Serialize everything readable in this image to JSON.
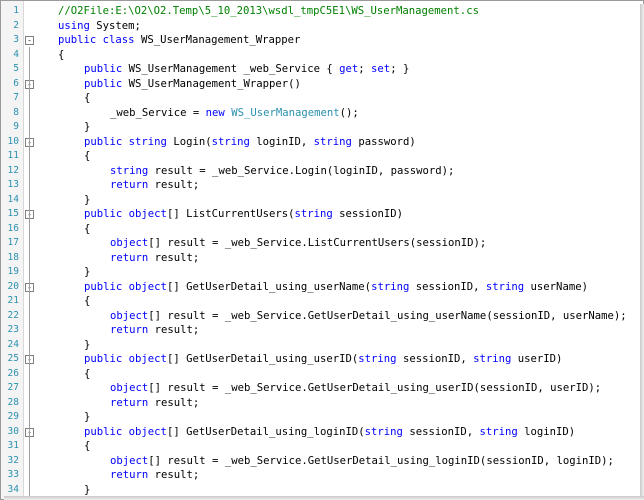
{
  "editor": {
    "lines": [
      {
        "n": "1",
        "indent": 0,
        "tokens": [
          {
            "t": "//O2File:E:\\O2\\O2.Temp\\5_10_2013\\wsdl_tmpC5E1\\WS_UserManagement.cs",
            "c": "cm"
          }
        ]
      },
      {
        "n": "2",
        "indent": 0,
        "tokens": [
          {
            "t": "using",
            "c": "kw"
          },
          {
            "t": " System;",
            "c": "pl"
          }
        ]
      },
      {
        "n": "3",
        "indent": 0,
        "fold": "-",
        "tokens": [
          {
            "t": "public",
            "c": "kw"
          },
          {
            "t": " ",
            "c": "pl"
          },
          {
            "t": "class",
            "c": "kw"
          },
          {
            "t": " WS_UserManagement_Wrapper",
            "c": "pl"
          }
        ]
      },
      {
        "n": "4",
        "indent": 0,
        "tokens": [
          {
            "t": "{",
            "c": "pl"
          }
        ]
      },
      {
        "n": "5",
        "indent": 1,
        "tokens": [
          {
            "t": "public",
            "c": "kw"
          },
          {
            "t": " WS_UserManagement _web_Service { ",
            "c": "pl"
          },
          {
            "t": "get",
            "c": "kw"
          },
          {
            "t": "; ",
            "c": "pl"
          },
          {
            "t": "set",
            "c": "kw"
          },
          {
            "t": "; }",
            "c": "pl"
          }
        ]
      },
      {
        "n": "6",
        "indent": 1,
        "fold": "-",
        "tokens": [
          {
            "t": "public",
            "c": "kw"
          },
          {
            "t": " WS_UserManagement_Wrapper()",
            "c": "pl"
          }
        ]
      },
      {
        "n": "7",
        "indent": 1,
        "tokens": [
          {
            "t": "{",
            "c": "pl"
          }
        ]
      },
      {
        "n": "8",
        "indent": 2,
        "tokens": [
          {
            "t": "_web_Service = ",
            "c": "pl"
          },
          {
            "t": "new",
            "c": "kw"
          },
          {
            "t": " ",
            "c": "pl"
          },
          {
            "t": "WS_UserManagement",
            "c": "ty"
          },
          {
            "t": "();",
            "c": "pl"
          }
        ]
      },
      {
        "n": "9",
        "indent": 1,
        "tokens": [
          {
            "t": "}",
            "c": "pl"
          }
        ]
      },
      {
        "n": "10",
        "indent": 1,
        "fold": "-",
        "tokens": [
          {
            "t": "public",
            "c": "kw"
          },
          {
            "t": " ",
            "c": "pl"
          },
          {
            "t": "string",
            "c": "kw"
          },
          {
            "t": " Login(",
            "c": "pl"
          },
          {
            "t": "string",
            "c": "kw"
          },
          {
            "t": " loginID, ",
            "c": "pl"
          },
          {
            "t": "string",
            "c": "kw"
          },
          {
            "t": " password)",
            "c": "pl"
          }
        ]
      },
      {
        "n": "11",
        "indent": 1,
        "tokens": [
          {
            "t": "{",
            "c": "pl"
          }
        ]
      },
      {
        "n": "12",
        "indent": 2,
        "tokens": [
          {
            "t": "string",
            "c": "kw"
          },
          {
            "t": " result = _web_Service.Login(loginID, password);",
            "c": "pl"
          }
        ]
      },
      {
        "n": "13",
        "indent": 2,
        "tokens": [
          {
            "t": "return",
            "c": "kw"
          },
          {
            "t": " result;",
            "c": "pl"
          }
        ]
      },
      {
        "n": "14",
        "indent": 1,
        "tokens": [
          {
            "t": "}",
            "c": "pl"
          }
        ]
      },
      {
        "n": "15",
        "indent": 1,
        "fold": "-",
        "tokens": [
          {
            "t": "public",
            "c": "kw"
          },
          {
            "t": " ",
            "c": "pl"
          },
          {
            "t": "object",
            "c": "kw"
          },
          {
            "t": "[] ListCurrentUsers(",
            "c": "pl"
          },
          {
            "t": "string",
            "c": "kw"
          },
          {
            "t": " sessionID)",
            "c": "pl"
          }
        ]
      },
      {
        "n": "16",
        "indent": 1,
        "tokens": [
          {
            "t": "{",
            "c": "pl"
          }
        ]
      },
      {
        "n": "17",
        "indent": 2,
        "tokens": [
          {
            "t": "object",
            "c": "kw"
          },
          {
            "t": "[] result = _web_Service.ListCurrentUsers(sessionID);",
            "c": "pl"
          }
        ]
      },
      {
        "n": "18",
        "indent": 2,
        "tokens": [
          {
            "t": "return",
            "c": "kw"
          },
          {
            "t": " result;",
            "c": "pl"
          }
        ]
      },
      {
        "n": "19",
        "indent": 1,
        "tokens": [
          {
            "t": "}",
            "c": "pl"
          }
        ]
      },
      {
        "n": "20",
        "indent": 1,
        "fold": "-",
        "tokens": [
          {
            "t": "public",
            "c": "kw"
          },
          {
            "t": " ",
            "c": "pl"
          },
          {
            "t": "object",
            "c": "kw"
          },
          {
            "t": "[] GetUserDetail_using_userName(",
            "c": "pl"
          },
          {
            "t": "string",
            "c": "kw"
          },
          {
            "t": " sessionID, ",
            "c": "pl"
          },
          {
            "t": "string",
            "c": "kw"
          },
          {
            "t": " userName)",
            "c": "pl"
          }
        ]
      },
      {
        "n": "21",
        "indent": 1,
        "tokens": [
          {
            "t": "{",
            "c": "pl"
          }
        ]
      },
      {
        "n": "22",
        "indent": 2,
        "tokens": [
          {
            "t": "object",
            "c": "kw"
          },
          {
            "t": "[] result = _web_Service.GetUserDetail_using_userName(sessionID, userName);",
            "c": "pl"
          }
        ]
      },
      {
        "n": "23",
        "indent": 2,
        "tokens": [
          {
            "t": "return",
            "c": "kw"
          },
          {
            "t": " result;",
            "c": "pl"
          }
        ]
      },
      {
        "n": "24",
        "indent": 1,
        "tokens": [
          {
            "t": "}",
            "c": "pl"
          }
        ]
      },
      {
        "n": "25",
        "indent": 1,
        "fold": "-",
        "tokens": [
          {
            "t": "public",
            "c": "kw"
          },
          {
            "t": " ",
            "c": "pl"
          },
          {
            "t": "object",
            "c": "kw"
          },
          {
            "t": "[] GetUserDetail_using_userID(",
            "c": "pl"
          },
          {
            "t": "string",
            "c": "kw"
          },
          {
            "t": " sessionID, ",
            "c": "pl"
          },
          {
            "t": "string",
            "c": "kw"
          },
          {
            "t": " userID)",
            "c": "pl"
          }
        ]
      },
      {
        "n": "26",
        "indent": 1,
        "tokens": [
          {
            "t": "{",
            "c": "pl"
          }
        ]
      },
      {
        "n": "27",
        "indent": 2,
        "tokens": [
          {
            "t": "object",
            "c": "kw"
          },
          {
            "t": "[] result = _web_Service.GetUserDetail_using_userID(sessionID, userID);",
            "c": "pl"
          }
        ]
      },
      {
        "n": "28",
        "indent": 2,
        "tokens": [
          {
            "t": "return",
            "c": "kw"
          },
          {
            "t": " result;",
            "c": "pl"
          }
        ]
      },
      {
        "n": "29",
        "indent": 1,
        "tokens": [
          {
            "t": "}",
            "c": "pl"
          }
        ]
      },
      {
        "n": "30",
        "indent": 1,
        "fold": "-",
        "tokens": [
          {
            "t": "public",
            "c": "kw"
          },
          {
            "t": " ",
            "c": "pl"
          },
          {
            "t": "object",
            "c": "kw"
          },
          {
            "t": "[] GetUserDetail_using_loginID(",
            "c": "pl"
          },
          {
            "t": "string",
            "c": "kw"
          },
          {
            "t": " sessionID, ",
            "c": "pl"
          },
          {
            "t": "string",
            "c": "kw"
          },
          {
            "t": " loginID)",
            "c": "pl"
          }
        ]
      },
      {
        "n": "31",
        "indent": 1,
        "tokens": [
          {
            "t": "{",
            "c": "pl"
          }
        ]
      },
      {
        "n": "32",
        "indent": 2,
        "tokens": [
          {
            "t": "object",
            "c": "kw"
          },
          {
            "t": "[] result = _web_Service.GetUserDetail_using_loginID(sessionID, loginID);",
            "c": "pl"
          }
        ]
      },
      {
        "n": "33",
        "indent": 2,
        "tokens": [
          {
            "t": "return",
            "c": "kw"
          },
          {
            "t": " result;",
            "c": "pl"
          }
        ]
      },
      {
        "n": "34",
        "indent": 1,
        "tokens": [
          {
            "t": "}",
            "c": "pl"
          }
        ]
      }
    ]
  }
}
